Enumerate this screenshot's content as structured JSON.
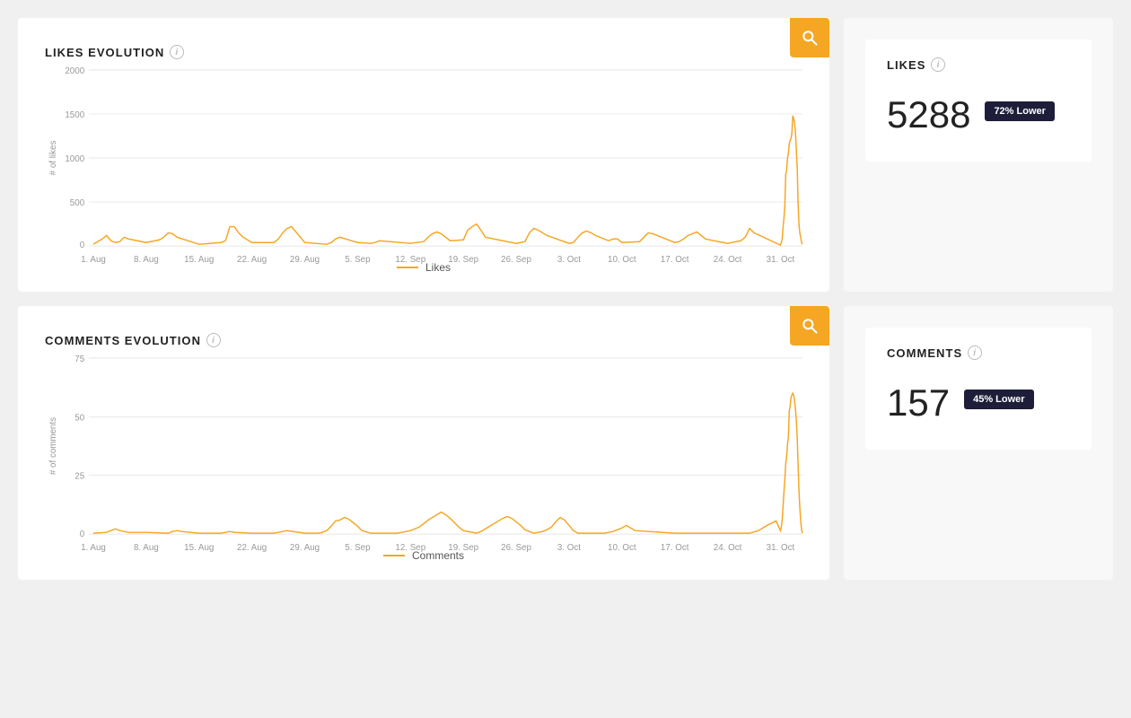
{
  "likes_section": {
    "chart_title": "LIKES EVOLUTION",
    "info": "i",
    "legend_label": "Likes",
    "zoom_icon": "search-icon",
    "y_axis_label": "# of likes",
    "y_ticks": [
      0,
      500,
      1000,
      1500,
      2000
    ],
    "x_labels": [
      "1. Aug",
      "8. Aug",
      "15. Aug",
      "22. Aug",
      "29. Aug",
      "5. Sep",
      "12. Sep",
      "19. Sep",
      "26. Sep",
      "3. Oct",
      "10. Oct",
      "17. Oct",
      "24. Oct",
      "31. Oct"
    ],
    "stats": {
      "label": "LIKES",
      "value": "5288",
      "badge": "72% Lower"
    }
  },
  "comments_section": {
    "chart_title": "COMMENTS EVOLUTION",
    "info": "i",
    "legend_label": "Comments",
    "zoom_icon": "search-icon",
    "y_axis_label": "# of comments",
    "y_ticks": [
      0,
      25,
      50,
      75
    ],
    "x_labels": [
      "1. Aug",
      "8. Aug",
      "15. Aug",
      "22. Aug",
      "29. Aug",
      "5. Sep",
      "12. Sep",
      "19. Sep",
      "26. Sep",
      "3. Oct",
      "10. Oct",
      "17. Oct",
      "24. Oct",
      "31. Oct"
    ],
    "stats": {
      "label": "COMMENTS",
      "value": "157",
      "badge": "45% Lower"
    }
  }
}
